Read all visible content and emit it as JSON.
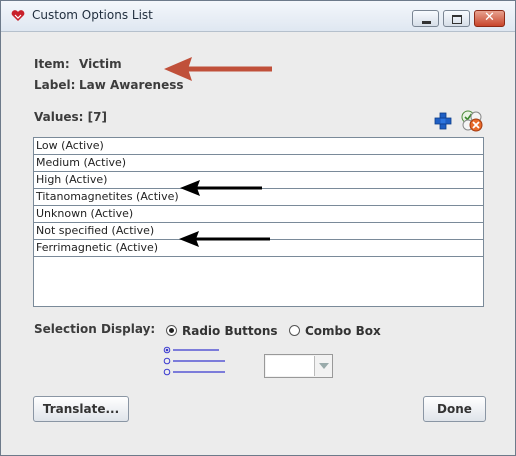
{
  "window": {
    "title": "Custom Options List",
    "app_icon": "heart-app-icon",
    "controls": {
      "minimize_icon": "minimize-icon",
      "maximize_icon": "maximize-icon",
      "close_symbol": "✕"
    }
  },
  "item": {
    "key": "Item:",
    "value": "Victim"
  },
  "label": {
    "key": "Label:",
    "value": "Law Awareness"
  },
  "values": {
    "heading": "Values: [7]",
    "add_icon": "plus-icon",
    "remove_icon": "remove-items-icon",
    "items": [
      "Low (Active)",
      "Medium (Active)",
      "High (Active)",
      "Titanomagnetites (Active)",
      "Unknown (Active)",
      "Not specified (Active)",
      "Ferrimagnetic (Active)"
    ]
  },
  "selection_display": {
    "label": "Selection Display:",
    "options": [
      "Radio Buttons",
      "Combo Box"
    ],
    "selected": "Radio Buttons"
  },
  "buttons": {
    "translate": "Translate...",
    "done": "Done"
  },
  "colors": {
    "red_arrow": "#c0503a",
    "black_arrow": "#000000",
    "accent_blue": "#2e6fd6",
    "preview_blue": "#3a3ad0"
  }
}
